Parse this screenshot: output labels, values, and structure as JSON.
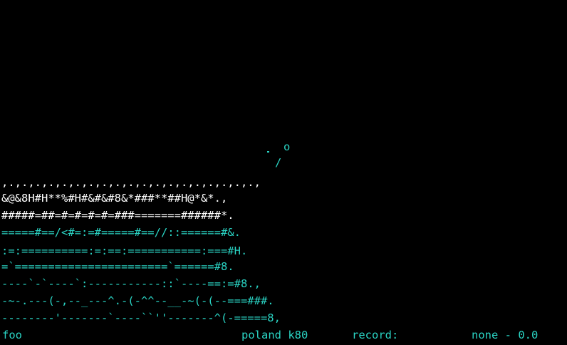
{
  "jumper": {
    "head": "o",
    "body": "/"
  },
  "hill_rows": [
    ",.,.,.,.,.,.,.,.,.,.,.,.,.,.,.,.,.,.,.,",
    "&@&8H#H**%#H#&#&#8&*###**##H@*&*.,",
    "#####=##=#=#=#=#=###=======######*.",
    "=====#==/<#=:=#=====#==//::======#&.",
    ":=:==========:=:==:===========:===#H.",
    "=`=======================`======#8.",
    "----`-`----`:-----------::`----==:=#8.,",
    "-~-.---(-,--_---^.-(-^^--__-~(-(--===###.",
    "--------'-------`----``''-------^(-=====8,"
  ],
  "status": {
    "left": "foo",
    "hill": "poland k80",
    "record_label": "record:",
    "record_value": "none - 0.0"
  },
  "colors": {
    "background": "#000000",
    "hill_primary": "#ffffff",
    "hill_accent": "#2ad4c4",
    "status": "#2ad4c4"
  }
}
